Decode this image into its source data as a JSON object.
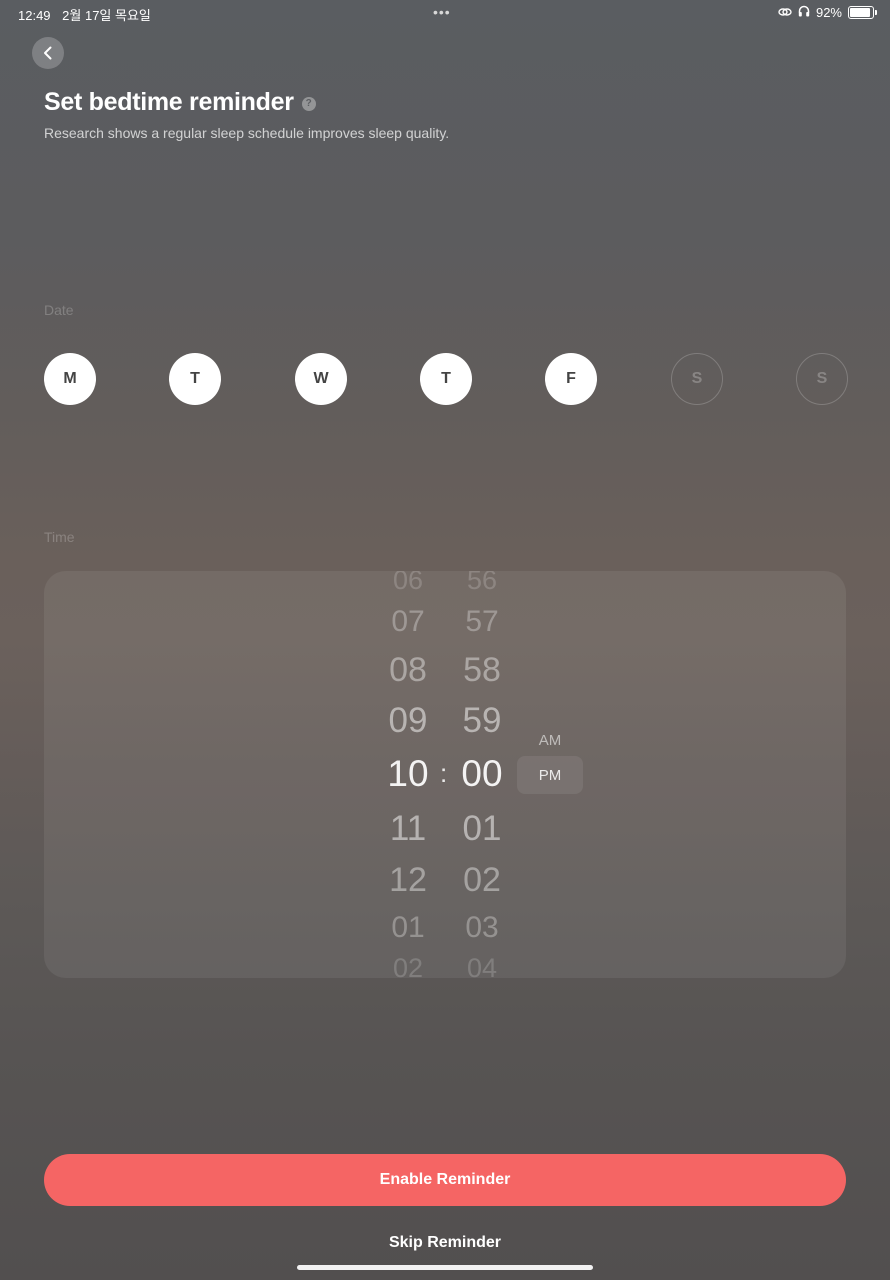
{
  "status_bar": {
    "time": "12:49",
    "date": "2월 17일 목요일",
    "dots": "•••",
    "battery_percent": "92%",
    "battery_level": 0.92
  },
  "header": {
    "title": "Set bedtime reminder",
    "help_glyph": "?",
    "subtitle": "Research shows a regular sleep schedule improves sleep quality."
  },
  "date_section": {
    "label": "Date",
    "days": [
      {
        "label": "M",
        "selected": true
      },
      {
        "label": "T",
        "selected": true
      },
      {
        "label": "W",
        "selected": true
      },
      {
        "label": "T",
        "selected": true
      },
      {
        "label": "F",
        "selected": true
      },
      {
        "label": "S",
        "selected": false
      },
      {
        "label": "S",
        "selected": false
      }
    ]
  },
  "time_section": {
    "label": "Time",
    "hours": [
      "06",
      "07",
      "08",
      "09",
      "10",
      "11",
      "12",
      "01",
      "02"
    ],
    "minutes": [
      "56",
      "57",
      "58",
      "59",
      "00",
      "01",
      "02",
      "03",
      "04"
    ],
    "separator": ":",
    "selected_hour": "10",
    "selected_minute": "00",
    "periods": [
      "AM",
      "PM"
    ],
    "selected_period": "PM"
  },
  "actions": {
    "enable_label": "Enable Reminder",
    "skip_label": "Skip Reminder"
  },
  "colors": {
    "accent": "#f56564"
  }
}
